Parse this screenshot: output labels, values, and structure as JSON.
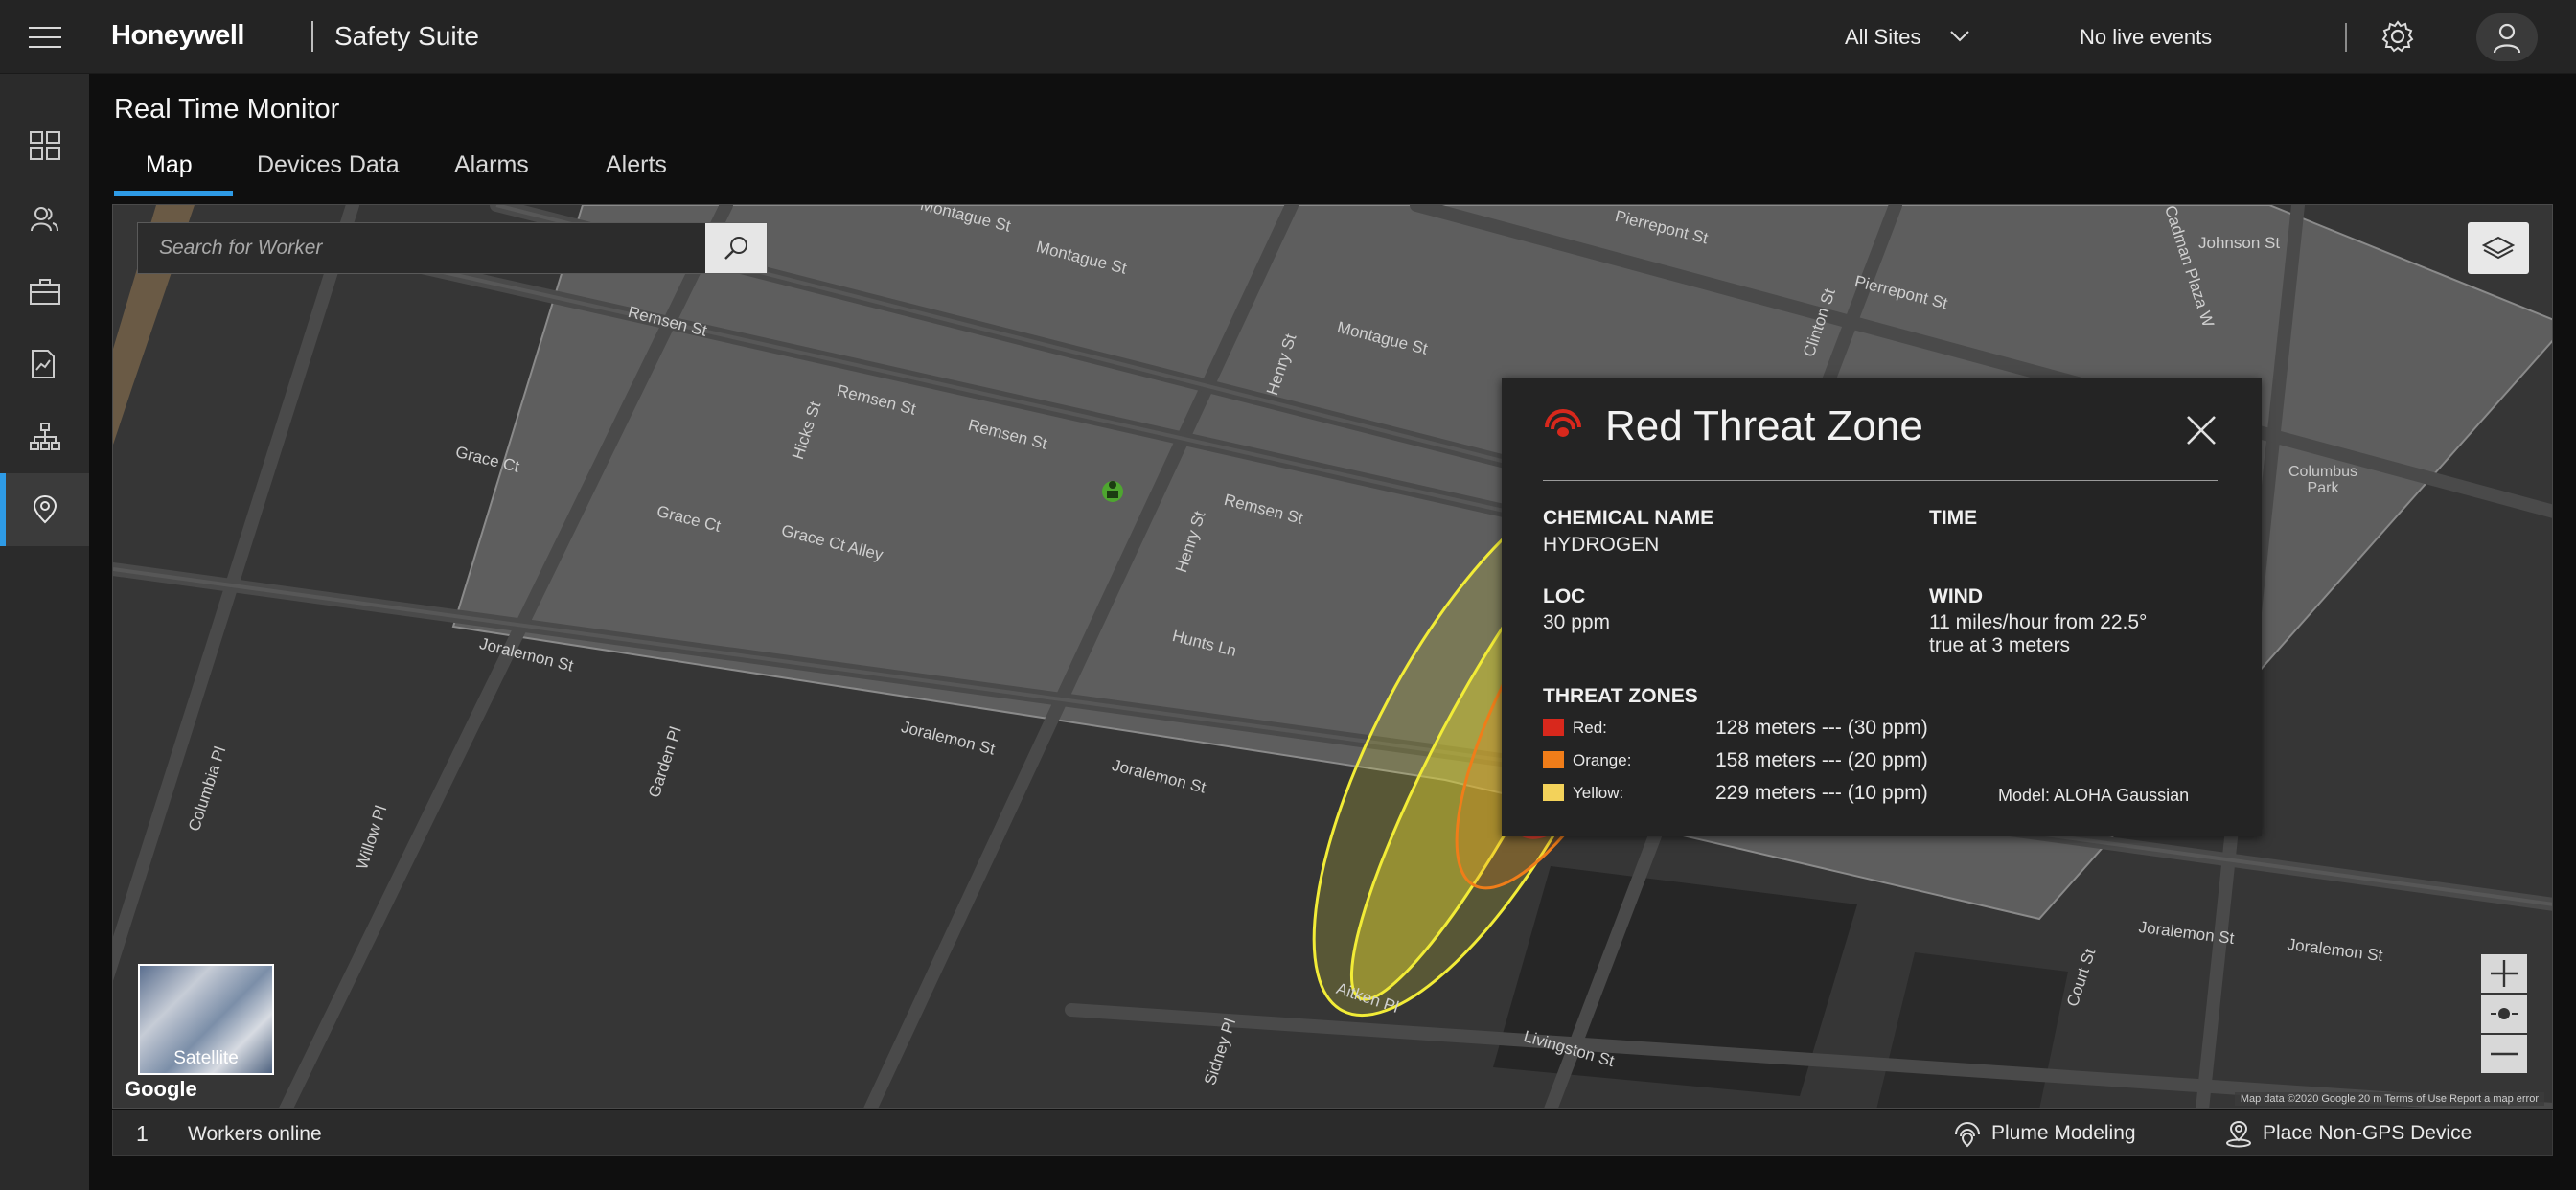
{
  "header": {
    "brand": "Honeywell",
    "product": "Safety Suite",
    "site_selector": "All Sites",
    "events_status": "No live events"
  },
  "sidebar": {
    "items": [
      {
        "icon": "dashboard-icon"
      },
      {
        "icon": "users-icon"
      },
      {
        "icon": "toolbox-icon"
      },
      {
        "icon": "report-icon"
      },
      {
        "icon": "hierarchy-icon"
      },
      {
        "icon": "location-pin-icon",
        "active": true
      }
    ]
  },
  "page": {
    "title": "Real Time Monitor",
    "tabs": [
      {
        "label": "Map",
        "active": true
      },
      {
        "label": "Devices Data"
      },
      {
        "label": "Alarms"
      },
      {
        "label": "Alerts"
      }
    ]
  },
  "map": {
    "search_placeholder": "Search for Worker",
    "satellite_label": "Satellite",
    "google_label": "Google",
    "attribution": "Map data ©2020 Google   20 m   Terms of Use   Report a map error",
    "streets": [
      "Montague St",
      "Pierrepont St",
      "Johnson St",
      "Remsen St",
      "Grace Ct",
      "Grace Ct Alley",
      "Hicks St",
      "Henry St",
      "Clinton St",
      "Hunts Ln",
      "Joralemon St",
      "Columbia Pl",
      "Willow Pl",
      "Garden Pl",
      "Sidney Pl",
      "Aitken Pl",
      "Livingston St",
      "Court St",
      "Cadman Plaza W",
      "Columbus Park"
    ]
  },
  "threat_popup": {
    "title": "Red Threat Zone",
    "chemical_label": "CHEMICAL NAME",
    "chemical_value": "HYDROGEN",
    "time_label": "TIME",
    "time_value": "",
    "loc_label": "LOC",
    "loc_value": "30 ppm",
    "wind_label": "WIND",
    "wind_value_1": "11 miles/hour from 22.5°",
    "wind_value_2": "true at 3 meters",
    "zones_label": "THREAT ZONES",
    "zones": [
      {
        "name": "Red:",
        "value": "128 meters --- (30 ppm)",
        "color": "#d8281c"
      },
      {
        "name": "Orange:",
        "value": "158 meters --- (20 ppm)",
        "color": "#f07d19"
      },
      {
        "name": "Yellow:",
        "value": "229 meters --- (10 ppm)",
        "color": "#f3d25a"
      }
    ],
    "model": "Model: ALOHA Gaussian"
  },
  "footer": {
    "workers_count": "1",
    "workers_label": "Workers online",
    "plume_label": "Plume Modeling",
    "place_label": "Place Non-GPS Device"
  },
  "colors": {
    "accent": "#2e9be6",
    "plume_red": "#e8412f",
    "plume_orange": "#f07d19",
    "plume_yellow": "#f2ec37"
  }
}
